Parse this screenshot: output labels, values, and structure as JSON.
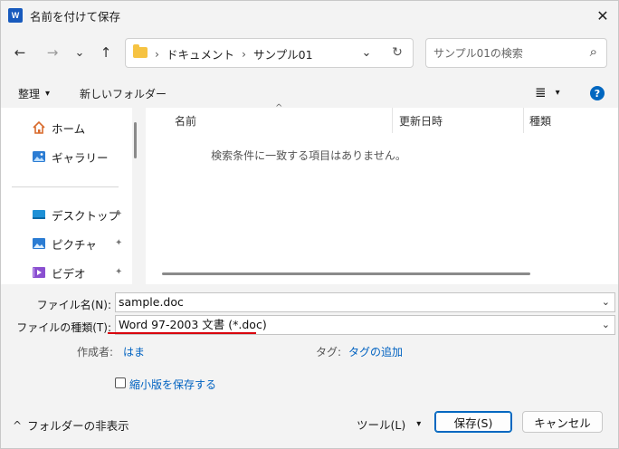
{
  "window": {
    "title": "名前を付けて保存",
    "app_icon_letter": "W",
    "close_glyph": "✕"
  },
  "nav": {
    "back_glyph": "←",
    "forward_glyph": "→",
    "recent_glyph": "⌄",
    "up_glyph": "↑",
    "crumb_sep": "›",
    "breadcrumbs": [
      "ドキュメント",
      "サンプル01"
    ],
    "address_dropdown_glyph": "⌄",
    "refresh_glyph": "↻",
    "search_placeholder": "サンプル01の検索",
    "search_glyph": "⌕"
  },
  "toolbar": {
    "organize_label": "整理",
    "organize_arrow": "▾",
    "new_folder_label": "新しいフォルダー",
    "view_glyph": "≣",
    "view_arrow": "▾",
    "help_glyph": "?"
  },
  "sidebar": {
    "items": [
      {
        "label": "ホーム",
        "icon": "home-icon",
        "pinned": false
      },
      {
        "label": "ギャラリー",
        "icon": "gallery-icon",
        "pinned": false
      },
      {
        "label": "デスクトップ",
        "icon": "desktop-icon",
        "pinned": true
      },
      {
        "label": "ピクチャ",
        "icon": "pictures-icon",
        "pinned": true
      },
      {
        "label": "ビデオ",
        "icon": "video-icon",
        "pinned": true
      }
    ],
    "pin_glyph": "📌"
  },
  "filelist": {
    "columns": [
      "名前",
      "更新日時",
      "種類"
    ],
    "sort_glyph": "^",
    "empty_message": "検索条件に一致する項目はありません。"
  },
  "form": {
    "filename_label": "ファイル名(N):",
    "filename_value": "sample.doc",
    "filetype_label": "ファイルの種類(T):",
    "filetype_value": "Word 97-2003 文書 (*.doc)",
    "author_label": "作成者:",
    "author_value": "はま",
    "tags_label": "タグ:",
    "tags_value": "タグの追加",
    "thumbnail_label": "縮小版を保存する",
    "thumbnail_checked": false,
    "dropdown_glyph": "⌄"
  },
  "footer": {
    "hide_folders_glyph": "^",
    "hide_folders_label": "フォルダーの非表示",
    "tools_label": "ツール(L)",
    "tools_arrow": "▾",
    "save_label": "保存(S)",
    "cancel_label": "キャンセル"
  },
  "colors": {
    "accent": "#0067c0",
    "highlight_underline": "#d8000c",
    "word_blue": "#185abd"
  }
}
